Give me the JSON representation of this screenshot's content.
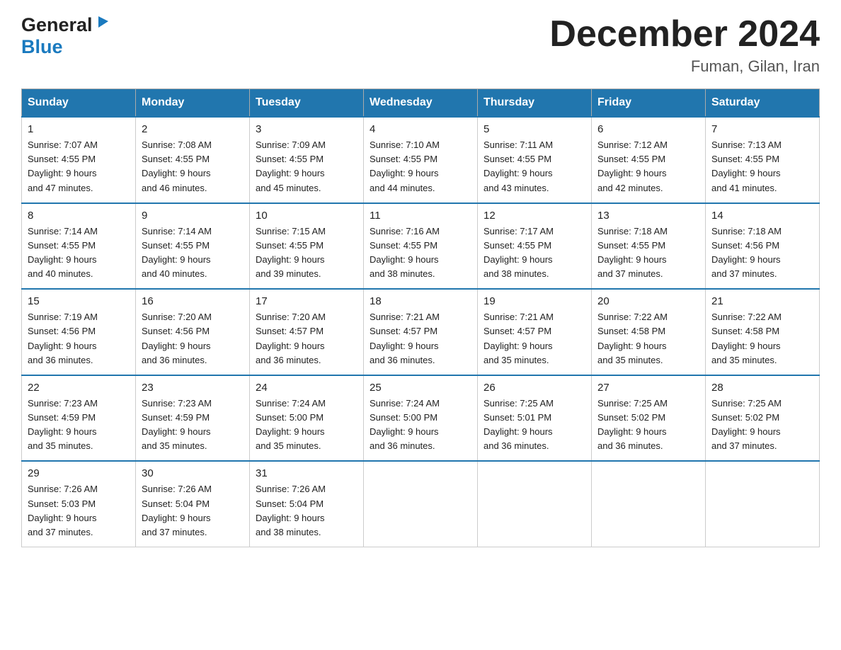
{
  "header": {
    "logo_general": "General",
    "logo_blue": "Blue",
    "month_year": "December 2024",
    "location": "Fuman, Gilan, Iran"
  },
  "weekdays": [
    "Sunday",
    "Monday",
    "Tuesday",
    "Wednesday",
    "Thursday",
    "Friday",
    "Saturday"
  ],
  "weeks": [
    [
      {
        "day": "1",
        "sunrise": "7:07 AM",
        "sunset": "4:55 PM",
        "daylight": "9 hours and 47 minutes."
      },
      {
        "day": "2",
        "sunrise": "7:08 AM",
        "sunset": "4:55 PM",
        "daylight": "9 hours and 46 minutes."
      },
      {
        "day": "3",
        "sunrise": "7:09 AM",
        "sunset": "4:55 PM",
        "daylight": "9 hours and 45 minutes."
      },
      {
        "day": "4",
        "sunrise": "7:10 AM",
        "sunset": "4:55 PM",
        "daylight": "9 hours and 44 minutes."
      },
      {
        "day": "5",
        "sunrise": "7:11 AM",
        "sunset": "4:55 PM",
        "daylight": "9 hours and 43 minutes."
      },
      {
        "day": "6",
        "sunrise": "7:12 AM",
        "sunset": "4:55 PM",
        "daylight": "9 hours and 42 minutes."
      },
      {
        "day": "7",
        "sunrise": "7:13 AM",
        "sunset": "4:55 PM",
        "daylight": "9 hours and 41 minutes."
      }
    ],
    [
      {
        "day": "8",
        "sunrise": "7:14 AM",
        "sunset": "4:55 PM",
        "daylight": "9 hours and 40 minutes."
      },
      {
        "day": "9",
        "sunrise": "7:14 AM",
        "sunset": "4:55 PM",
        "daylight": "9 hours and 40 minutes."
      },
      {
        "day": "10",
        "sunrise": "7:15 AM",
        "sunset": "4:55 PM",
        "daylight": "9 hours and 39 minutes."
      },
      {
        "day": "11",
        "sunrise": "7:16 AM",
        "sunset": "4:55 PM",
        "daylight": "9 hours and 38 minutes."
      },
      {
        "day": "12",
        "sunrise": "7:17 AM",
        "sunset": "4:55 PM",
        "daylight": "9 hours and 38 minutes."
      },
      {
        "day": "13",
        "sunrise": "7:18 AM",
        "sunset": "4:55 PM",
        "daylight": "9 hours and 37 minutes."
      },
      {
        "day": "14",
        "sunrise": "7:18 AM",
        "sunset": "4:56 PM",
        "daylight": "9 hours and 37 minutes."
      }
    ],
    [
      {
        "day": "15",
        "sunrise": "7:19 AM",
        "sunset": "4:56 PM",
        "daylight": "9 hours and 36 minutes."
      },
      {
        "day": "16",
        "sunrise": "7:20 AM",
        "sunset": "4:56 PM",
        "daylight": "9 hours and 36 minutes."
      },
      {
        "day": "17",
        "sunrise": "7:20 AM",
        "sunset": "4:57 PM",
        "daylight": "9 hours and 36 minutes."
      },
      {
        "day": "18",
        "sunrise": "7:21 AM",
        "sunset": "4:57 PM",
        "daylight": "9 hours and 36 minutes."
      },
      {
        "day": "19",
        "sunrise": "7:21 AM",
        "sunset": "4:57 PM",
        "daylight": "9 hours and 35 minutes."
      },
      {
        "day": "20",
        "sunrise": "7:22 AM",
        "sunset": "4:58 PM",
        "daylight": "9 hours and 35 minutes."
      },
      {
        "day": "21",
        "sunrise": "7:22 AM",
        "sunset": "4:58 PM",
        "daylight": "9 hours and 35 minutes."
      }
    ],
    [
      {
        "day": "22",
        "sunrise": "7:23 AM",
        "sunset": "4:59 PM",
        "daylight": "9 hours and 35 minutes."
      },
      {
        "day": "23",
        "sunrise": "7:23 AM",
        "sunset": "4:59 PM",
        "daylight": "9 hours and 35 minutes."
      },
      {
        "day": "24",
        "sunrise": "7:24 AM",
        "sunset": "5:00 PM",
        "daylight": "9 hours and 35 minutes."
      },
      {
        "day": "25",
        "sunrise": "7:24 AM",
        "sunset": "5:00 PM",
        "daylight": "9 hours and 36 minutes."
      },
      {
        "day": "26",
        "sunrise": "7:25 AM",
        "sunset": "5:01 PM",
        "daylight": "9 hours and 36 minutes."
      },
      {
        "day": "27",
        "sunrise": "7:25 AM",
        "sunset": "5:02 PM",
        "daylight": "9 hours and 36 minutes."
      },
      {
        "day": "28",
        "sunrise": "7:25 AM",
        "sunset": "5:02 PM",
        "daylight": "9 hours and 37 minutes."
      }
    ],
    [
      {
        "day": "29",
        "sunrise": "7:26 AM",
        "sunset": "5:03 PM",
        "daylight": "9 hours and 37 minutes."
      },
      {
        "day": "30",
        "sunrise": "7:26 AM",
        "sunset": "5:04 PM",
        "daylight": "9 hours and 37 minutes."
      },
      {
        "day": "31",
        "sunrise": "7:26 AM",
        "sunset": "5:04 PM",
        "daylight": "9 hours and 38 minutes."
      },
      null,
      null,
      null,
      null
    ]
  ],
  "labels": {
    "sunrise": "Sunrise:",
    "sunset": "Sunset:",
    "daylight": "Daylight:"
  }
}
